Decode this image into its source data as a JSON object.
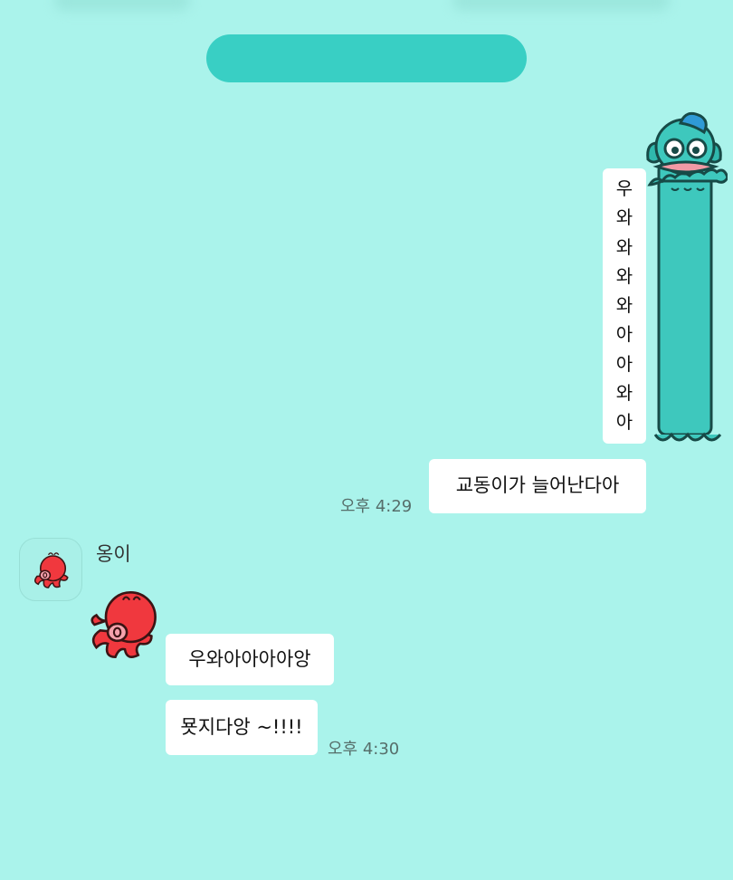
{
  "chat": {
    "messages": [
      {
        "direction": "outgoing",
        "type": "vertical-text",
        "characters": [
          "우",
          "와",
          "와",
          "와",
          "와",
          "아",
          "아",
          "와",
          "아"
        ]
      },
      {
        "direction": "outgoing",
        "text": "교동이가 늘어난다아",
        "time": "오후 4:29"
      },
      {
        "direction": "incoming",
        "sender": "옹이",
        "text": "우와아아아아앙"
      },
      {
        "direction": "incoming",
        "text": "묫지다앙 ~!!!!",
        "time": "오후 4:30"
      }
    ]
  },
  "stickers": {
    "outgoing": "fish-creature-sticker-icon",
    "incoming": "red-octopus-sticker-icon",
    "avatar": "red-octopus-avatar-icon"
  },
  "colors": {
    "background": "#aaf3eb",
    "header_pill": "#39cfc4",
    "bubble": "#ffffff",
    "time_text": "#566e6a",
    "octopus": "#f0383e",
    "fish": "#3ec8bd"
  }
}
